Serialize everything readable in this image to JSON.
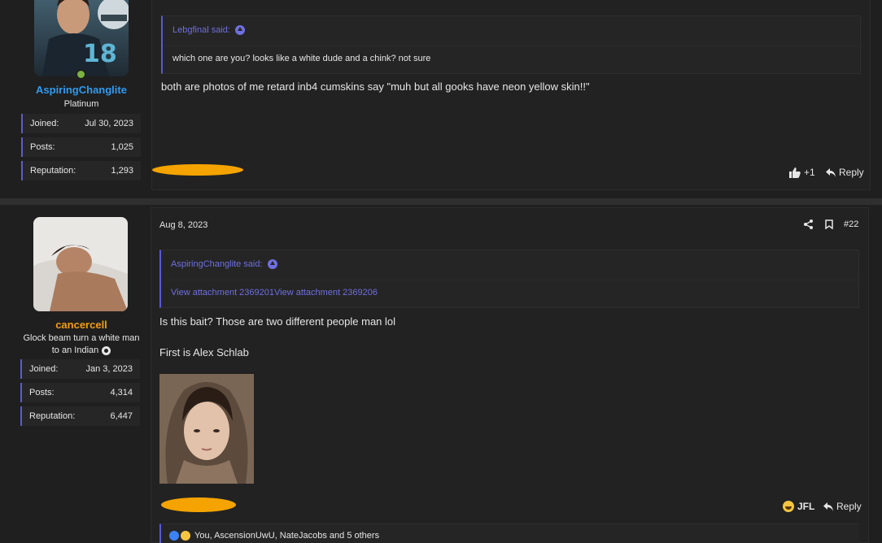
{
  "post1": {
    "username": "AspiringChanglite",
    "usertitle": "Platinum",
    "stats": [
      {
        "label": "Joined:",
        "value": "Jul 30, 2023"
      },
      {
        "label": "Posts:",
        "value": "1,025"
      },
      {
        "label": "Reputation:",
        "value": "1,293"
      }
    ],
    "quote_author": "Lebgfinal said:",
    "quote_text": "which one are you? looks like a white dude and a chink? not sure",
    "body": "both are photos of me retard inb4 cumskins say \"muh but all gooks have neon yellow skin!!\"",
    "reaction_count": "+1",
    "reply_label": "Reply"
  },
  "post2": {
    "date": "Aug 8, 2023",
    "post_number": "#22",
    "username": "cancercell",
    "usertitle_line1": "Glock beam turn a white man",
    "usertitle_line2": "to an Indian",
    "stats": [
      {
        "label": "Joined:",
        "value": "Jan 3, 2023"
      },
      {
        "label": "Posts:",
        "value": "4,314"
      },
      {
        "label": "Reputation:",
        "value": "6,447"
      }
    ],
    "quote_author": "AspiringChanglite said:",
    "quote_text": "View attachment 2369201View attachment 2369206",
    "body_line1": "Is this bait? Those are two different people man lol",
    "body_line2": "First is Alex Schlab",
    "reaction_label": "JFL",
    "reply_label": "Reply",
    "reactions_summary": "You, AscensionUwU, NateJacobs and 5 others"
  },
  "colors": {
    "username1": "#2e9bf0",
    "username2": "#f39c12",
    "accent": "#5a5ad6",
    "link": "#6f6fe0",
    "redaction": "#f4a300"
  }
}
